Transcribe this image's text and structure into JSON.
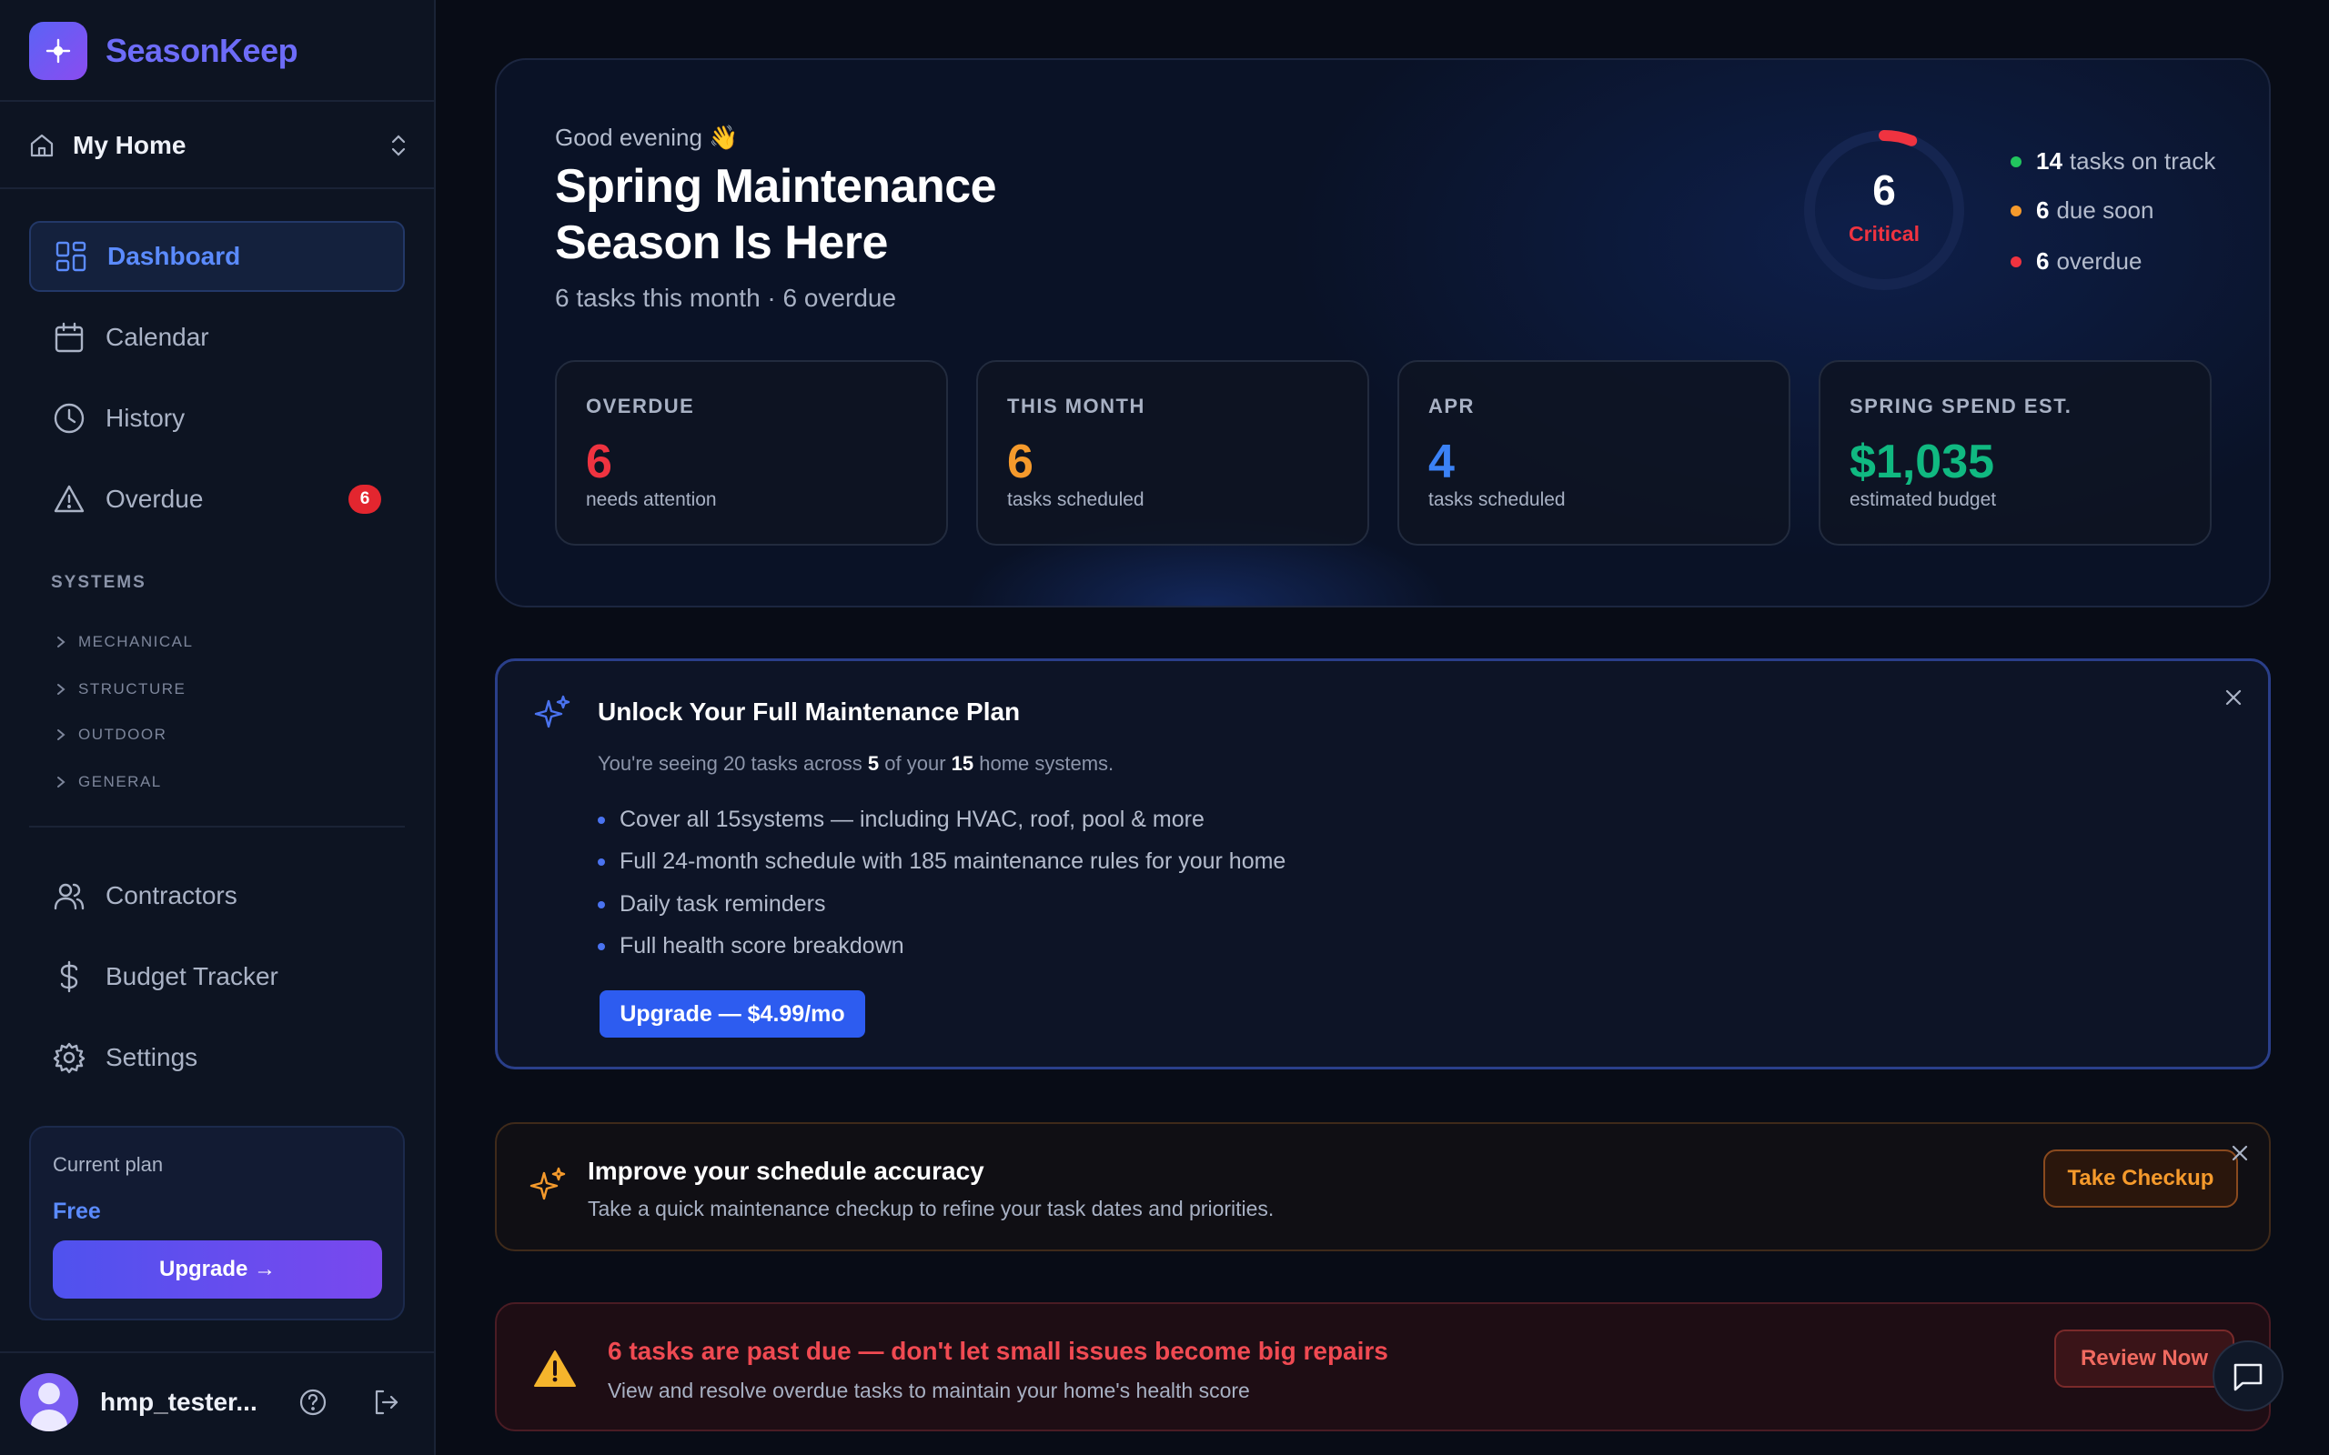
{
  "app": {
    "name": "SeasonKeep"
  },
  "home_switcher": {
    "label": "My Home"
  },
  "nav": {
    "dashboard": "Dashboard",
    "calendar": "Calendar",
    "history": "History",
    "overdue": "Overdue",
    "overdue_badge": "6",
    "contractors": "Contractors",
    "budget": "Budget Tracker",
    "settings": "Settings"
  },
  "systems": {
    "title": "SYSTEMS",
    "items": [
      "MECHANICAL",
      "STRUCTURE",
      "OUTDOOR",
      "GENERAL"
    ]
  },
  "plan": {
    "caption": "Current plan",
    "name": "Free",
    "button": "Upgrade →"
  },
  "user": {
    "name": "hmp_tester..."
  },
  "hero": {
    "greeting": "Good evening 👋",
    "title_line1": "Spring Maintenance",
    "title_line2": "Season Is Here",
    "subtitle": "6 tasks this month · 6 overdue",
    "score": {
      "value": "6",
      "label": "Critical",
      "fill_fraction": 0.06
    },
    "legend": [
      {
        "count": "14",
        "text": "tasks on track",
        "color": "#22c55e"
      },
      {
        "count": "6",
        "text": "due soon",
        "color": "#f59a2c"
      },
      {
        "count": "6",
        "text": "overdue",
        "color": "#ef3340"
      }
    ]
  },
  "stats": [
    {
      "title": "OVERDUE",
      "value": "6",
      "sub": "needs attention",
      "color": "#ef3340"
    },
    {
      "title": "THIS MONTH",
      "value": "6",
      "sub": "tasks scheduled",
      "color": "#f59a2c"
    },
    {
      "title": "APR",
      "value": "4",
      "sub": "tasks scheduled",
      "color": "#3b82f6"
    },
    {
      "title": "SPRING SPEND EST.",
      "value": "$1,035",
      "sub": "estimated budget",
      "color": "#10b981"
    }
  ],
  "upsell": {
    "title": "Unlock Your Full Maintenance Plan",
    "desc_prefix": "You're seeing 20 tasks across ",
    "desc_systems": "5",
    "desc_mid": " of your ",
    "desc_total": "15",
    "desc_suffix": " home systems.",
    "features": [
      "Cover all 15systems — including HVAC, roof, pool & more",
      "Full 24-month schedule with 185 maintenance rules for your home",
      "Daily task reminders",
      "Full health score breakdown"
    ],
    "button": "Upgrade — $4.99/mo"
  },
  "checkup": {
    "title": "Improve your schedule accuracy",
    "desc": "Take a quick maintenance checkup to refine your task dates and priorities.",
    "button": "Take Checkup"
  },
  "alert": {
    "title": "6 tasks are past due — don't let small issues become big repairs",
    "desc": "View and resolve overdue tasks to maintain your home's health score",
    "button": "Review Now"
  },
  "colors": {
    "accent": "#5b8bff",
    "brand": "#6d6cf8",
    "danger": "#ef3340",
    "warning": "#f59a2c",
    "success": "#10b981"
  }
}
